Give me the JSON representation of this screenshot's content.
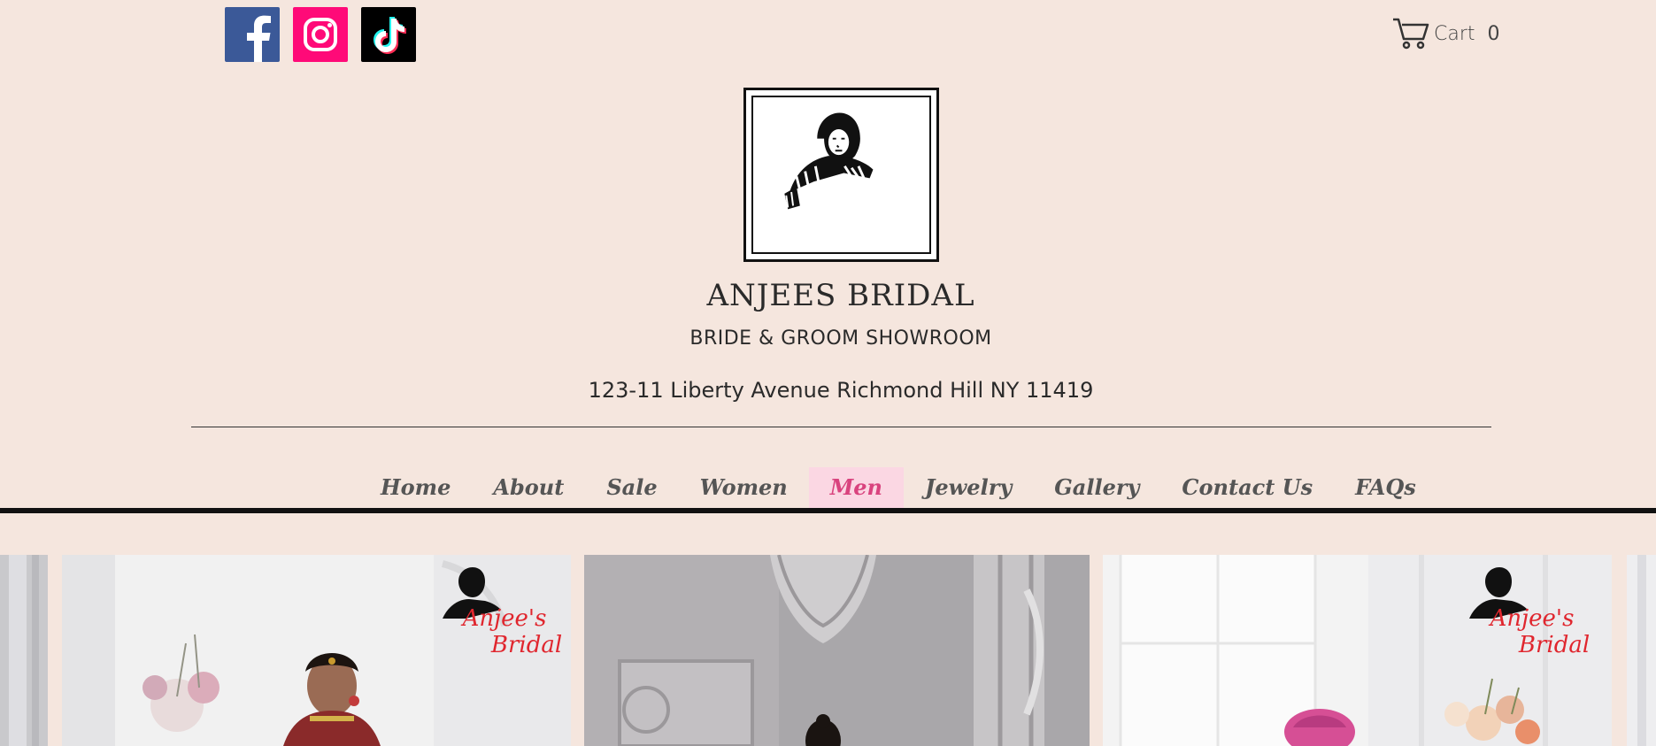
{
  "social": {
    "facebook": {
      "name": "facebook-icon",
      "color": "#3b5998"
    },
    "instagram": {
      "name": "instagram-icon",
      "color": "#ff0a78"
    },
    "tiktok": {
      "name": "tiktok-icon",
      "color": "#000000"
    }
  },
  "cart": {
    "label": "Cart",
    "count": "0",
    "icon": "cart-icon"
  },
  "logo": {
    "line1": "Anjee's",
    "line2": "Bridal"
  },
  "header": {
    "title": "ANJEES BRIDAL",
    "subtitle": "BRIDE & GROOM SHOWROOM",
    "address": "123-11 Liberty Avenue Richmond Hill NY 11419"
  },
  "nav": {
    "items": [
      {
        "label": "Home"
      },
      {
        "label": "About"
      },
      {
        "label": "Sale"
      },
      {
        "label": "Women"
      },
      {
        "label": "Men",
        "active": true
      },
      {
        "label": "Jewelry"
      },
      {
        "label": "Gallery"
      },
      {
        "label": "Contact Us"
      },
      {
        "label": "FAQs"
      }
    ]
  },
  "colors": {
    "background": "#f5e6de",
    "accent": "#d9437e",
    "active_bg": "#fbd7e3"
  }
}
